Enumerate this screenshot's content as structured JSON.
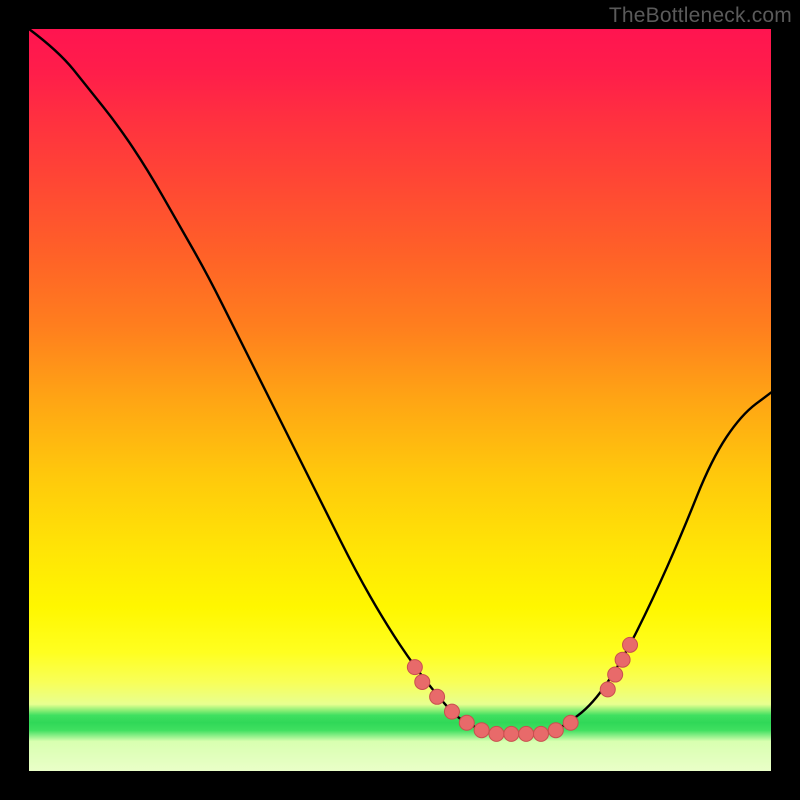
{
  "watermark": "TheBottleneck.com",
  "colors": {
    "curve": "#000000",
    "dot_fill": "#e86a6a",
    "dot_stroke": "#c94f4f"
  },
  "chart_data": {
    "type": "line",
    "title": "",
    "xlabel": "",
    "ylabel": "",
    "xlim": [
      0,
      100
    ],
    "ylim": [
      0,
      100
    ],
    "series": [
      {
        "name": "bottleneck-curve",
        "x": [
          0,
          4,
          8,
          12,
          16,
          20,
          24,
          28,
          32,
          36,
          40,
          44,
          48,
          52,
          56,
          58,
          60,
          62,
          64,
          66,
          68,
          70,
          72,
          76,
          80,
          84,
          88,
          92,
          96,
          100
        ],
        "y": [
          100,
          97,
          92,
          87,
          81,
          74,
          67,
          59,
          51,
          43,
          35,
          27,
          20,
          14,
          9,
          7,
          6,
          5,
          5,
          5,
          5,
          5,
          6,
          9,
          15,
          23,
          32,
          42,
          48,
          51
        ]
      }
    ],
    "dots": {
      "name": "highlight-dots",
      "points": [
        {
          "x": 52,
          "y": 14
        },
        {
          "x": 53,
          "y": 12
        },
        {
          "x": 55,
          "y": 10
        },
        {
          "x": 57,
          "y": 8
        },
        {
          "x": 59,
          "y": 6.5
        },
        {
          "x": 61,
          "y": 5.5
        },
        {
          "x": 63,
          "y": 5
        },
        {
          "x": 65,
          "y": 5
        },
        {
          "x": 67,
          "y": 5
        },
        {
          "x": 69,
          "y": 5
        },
        {
          "x": 71,
          "y": 5.5
        },
        {
          "x": 73,
          "y": 6.5
        },
        {
          "x": 78,
          "y": 11
        },
        {
          "x": 79,
          "y": 13
        },
        {
          "x": 80,
          "y": 15
        },
        {
          "x": 81,
          "y": 17
        }
      ]
    }
  }
}
